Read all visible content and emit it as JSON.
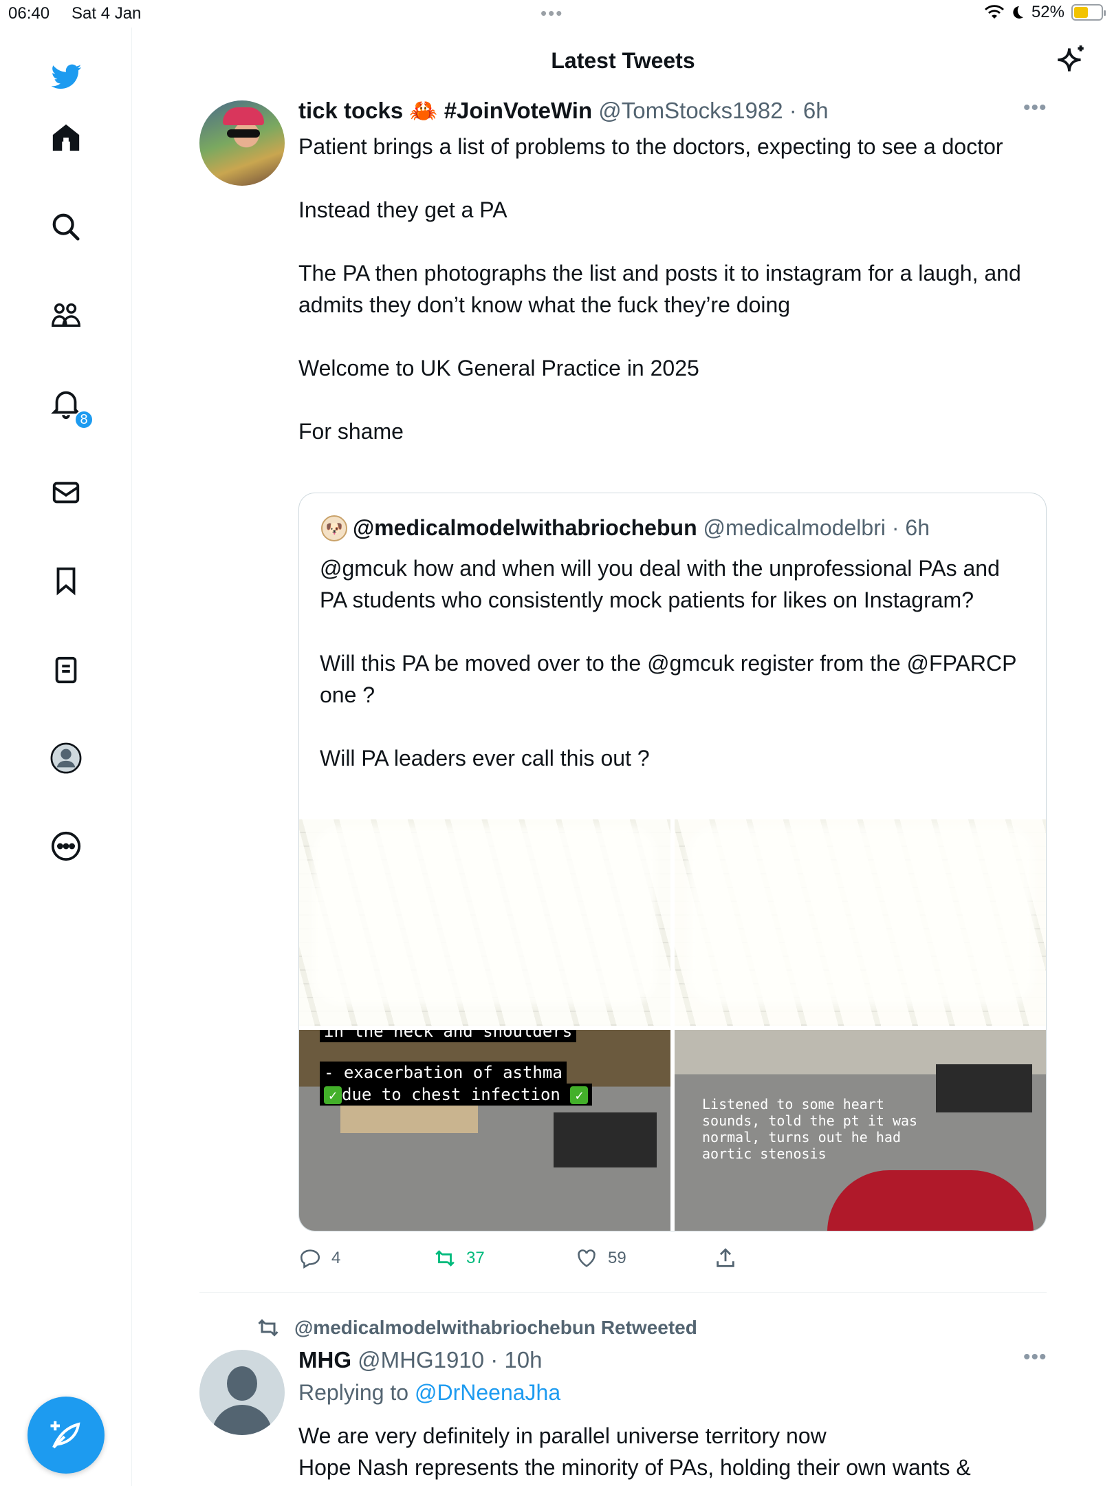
{
  "status_bar": {
    "time": "06:40",
    "date": "Sat 4 Jan",
    "battery": "52%",
    "battery_level": 0.52
  },
  "header": {
    "title": "Latest Tweets"
  },
  "sidebar": {
    "items": [
      {
        "name": "home",
        "icon": "home-icon"
      },
      {
        "name": "explore",
        "icon": "search-icon"
      },
      {
        "name": "communities",
        "icon": "communities-icon"
      },
      {
        "name": "notifications",
        "icon": "bell-icon",
        "badge": "8"
      },
      {
        "name": "messages",
        "icon": "envelope-icon"
      },
      {
        "name": "bookmarks",
        "icon": "bookmark-icon"
      },
      {
        "name": "lists",
        "icon": "list-icon"
      },
      {
        "name": "profile",
        "icon": "profile-icon"
      },
      {
        "name": "more",
        "icon": "more-circle-icon"
      }
    ],
    "accent": "#1d9bf0"
  },
  "tweet1": {
    "name": "tick tocks",
    "name_suffix": "#JoinVoteWin",
    "handle": "@TomStocks1982",
    "time": "6h",
    "paragraphs": [
      "Patient brings a list of problems to the doctors, expecting to see a doctor",
      "Instead they get a PA",
      "The PA then photographs the list and posts it to instagram for a laugh, and admits they don’t know what the fuck they’re doing",
      "Welcome to UK General Practice in 2025",
      "For shame"
    ],
    "quote": {
      "name": "@medicalmodelwithabriochebun",
      "handle": "@medicalmodelbri",
      "time": "6h",
      "paragraphs": [
        "@gmcuk how and when will you deal with the unprofessional PAs and PA students who consistently mock patients for likes on Instagram?",
        "Will this PA be moved over to the @gmcuk register from the @FPARCP one ?",
        "Will PA leaders ever call this out ?"
      ],
      "media": {
        "image3_line0": "in the neck and shoulders",
        "image3_line1": "- exacerbation of asthma",
        "image3_line2": "due to chest infection",
        "image4_caption": "Listened to some heart sounds, told the pt it was normal, turns out he had aortic stenosis"
      }
    },
    "actions": {
      "replies": "4",
      "retweets": "37",
      "likes": "59"
    }
  },
  "tweet2": {
    "retweeted_by": "@medicalmodelwithabriochebun Retweeted",
    "name": "MHG",
    "handle": "@MHG1910",
    "time": "10h",
    "replying_prefix": "Replying to",
    "replying_to": "@DrNeenaJha",
    "text_line1": "We are very definitely in parallel universe territory now",
    "text_line2": "Hope Nash represents the minority of PAs, holding their own wants &"
  }
}
